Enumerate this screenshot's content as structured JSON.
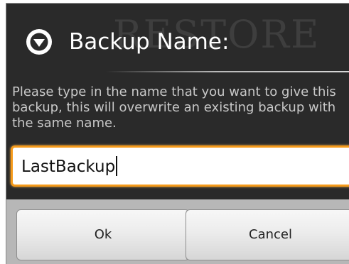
{
  "background": {
    "watermark_text": "RESTORE"
  },
  "dialog": {
    "title": "Backup Name:",
    "title_icon": "chevron-down-circle-icon",
    "message": "Please type in the name that you want to give this backup, this will overwrite an existing backup with the same name.",
    "input_value": "LastBackup",
    "ok_label": "Ok",
    "cancel_label": "Cancel"
  },
  "colors": {
    "dialog_background": "#2a2a2a",
    "focus_accent": "#f59a1a",
    "button_bar": "#b7b7b7"
  }
}
